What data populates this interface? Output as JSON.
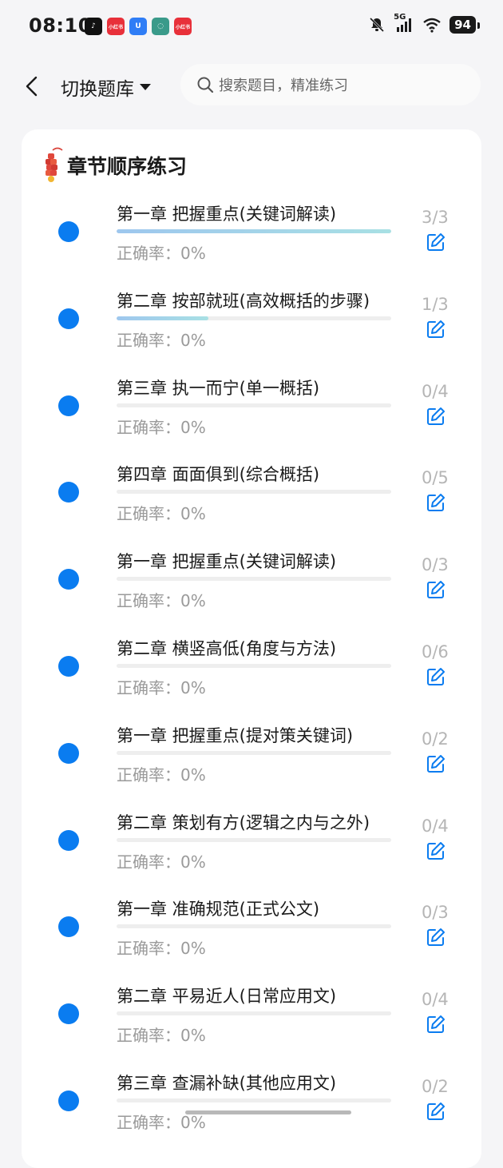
{
  "status_bar": {
    "time": "08:10",
    "app_icons": [
      {
        "name": "tiktok-icon",
        "glyph": "♪",
        "color": "#111111"
      },
      {
        "name": "xiaohongshu-icon",
        "glyph": "小红书",
        "color": "#e8303a"
      },
      {
        "name": "u-app-icon",
        "glyph": "U",
        "color": "#2f7df6"
      },
      {
        "name": "chat-bubble-icon",
        "glyph": "◌",
        "color": "#3a9a8a"
      },
      {
        "name": "xiaohongshu-icon-2",
        "glyph": "小红书",
        "color": "#e8303a"
      }
    ],
    "network": "5G",
    "battery": "94"
  },
  "header": {
    "switch_label": "切换题库",
    "search_placeholder": "搜索题目，精准练习"
  },
  "section": {
    "title": "章节顺序练习"
  },
  "chapters": [
    {
      "title": "第一章 把握重点(关键词解读)",
      "progress": 1.0,
      "accuracy": "正确率：0%",
      "count": "3/3"
    },
    {
      "title": "第二章 按部就班(高效概括的步骤)",
      "progress": 0.333,
      "accuracy": "正确率：0%",
      "count": "1/3"
    },
    {
      "title": "第三章 执一而宁(单一概括)",
      "progress": 0,
      "accuracy": "正确率：0%",
      "count": "0/4"
    },
    {
      "title": "第四章 面面俱到(综合概括)",
      "progress": 0,
      "accuracy": "正确率：0%",
      "count": "0/5"
    },
    {
      "title": "第一章 把握重点(关键词解读)",
      "progress": 0,
      "accuracy": "正确率：0%",
      "count": "0/3"
    },
    {
      "title": "第二章 横竖高低(角度与方法)",
      "progress": 0,
      "accuracy": "正确率：0%",
      "count": "0/6"
    },
    {
      "title": "第一章 把握重点(提对策关键词)",
      "progress": 0,
      "accuracy": "正确率：0%",
      "count": "0/2"
    },
    {
      "title": "第二章 策划有方(逻辑之内与之外)",
      "progress": 0,
      "accuracy": "正确率：0%",
      "count": "0/4"
    },
    {
      "title": "第一章 准确规范(正式公文)",
      "progress": 0,
      "accuracy": "正确率：0%",
      "count": "0/3"
    },
    {
      "title": "第二章 平易近人(日常应用文)",
      "progress": 0,
      "accuracy": "正确率：0%",
      "count": "0/4"
    },
    {
      "title": "第三章 查漏补缺(其他应用文)",
      "progress": 0,
      "accuracy": "正确率：0%",
      "count": "0/2"
    }
  ],
  "colors": {
    "accent": "#0a7cf0",
    "progress_fill": "#a8d4ea"
  }
}
